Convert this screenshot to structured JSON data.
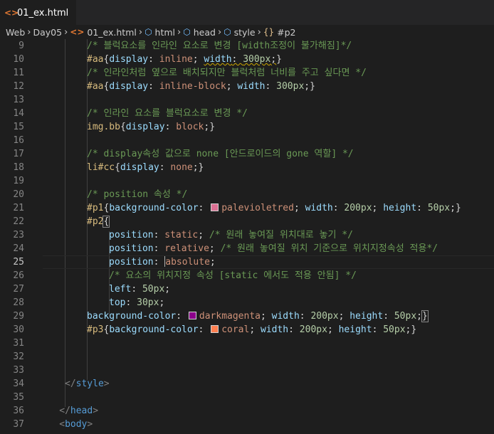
{
  "tab": {
    "filename": "01_ex.html",
    "icon": "html-file-icon"
  },
  "breadcrumb": {
    "items": [
      "Web",
      "Day05",
      "01_ex.html",
      "html",
      "head",
      "style",
      "#p2"
    ]
  },
  "editor": {
    "lines": [
      {
        "num": "9",
        "indent": 2,
        "tokens": [
          [
            "com",
            "/* 블럭요소를 인라인 요소로 변경 [width조정이 불가해짐]*/"
          ]
        ]
      },
      {
        "num": "10",
        "indent": 2,
        "tokens": [
          [
            "sel",
            "#aa"
          ],
          [
            "pun",
            "{"
          ],
          [
            "prop",
            "display"
          ],
          [
            "pun",
            ": "
          ],
          [
            "val",
            "inline"
          ],
          [
            "pun",
            "; "
          ],
          [
            "prop",
            "width",
            "sq"
          ],
          [
            "pun",
            ": ",
            "sq"
          ],
          [
            "num",
            "300px",
            "sq"
          ],
          [
            "pun",
            ";",
            "sq"
          ],
          [
            "pun",
            "}"
          ]
        ]
      },
      {
        "num": "11",
        "indent": 2,
        "tokens": [
          [
            "com",
            "/* 인라인처럼 옆으로 배치되지만 블럭처럼 너비를 주고 싶다면 */"
          ]
        ]
      },
      {
        "num": "12",
        "indent": 2,
        "tokens": [
          [
            "sel",
            "#aa"
          ],
          [
            "pun",
            "{"
          ],
          [
            "prop",
            "display"
          ],
          [
            "pun",
            ": "
          ],
          [
            "val",
            "inline-block"
          ],
          [
            "pun",
            "; "
          ],
          [
            "prop",
            "width"
          ],
          [
            "pun",
            ": "
          ],
          [
            "num",
            "300px"
          ],
          [
            "pun",
            ";}"
          ]
        ]
      },
      {
        "num": "13",
        "indent": 0,
        "tokens": []
      },
      {
        "num": "14",
        "indent": 2,
        "tokens": [
          [
            "com",
            "/* 인라인 요소를 블럭요소로 변경 */"
          ]
        ]
      },
      {
        "num": "15",
        "indent": 2,
        "tokens": [
          [
            "sel",
            "img.bb"
          ],
          [
            "pun",
            "{"
          ],
          [
            "prop",
            "display"
          ],
          [
            "pun",
            ": "
          ],
          [
            "val",
            "block"
          ],
          [
            "pun",
            ";}"
          ]
        ]
      },
      {
        "num": "16",
        "indent": 0,
        "tokens": []
      },
      {
        "num": "17",
        "indent": 2,
        "tokens": [
          [
            "com",
            "/* display속성 값으로 none [안드로이드의 gone 역할] */"
          ]
        ]
      },
      {
        "num": "18",
        "indent": 2,
        "tokens": [
          [
            "sel",
            "li#cc"
          ],
          [
            "pun",
            "{"
          ],
          [
            "prop",
            "display"
          ],
          [
            "pun",
            ": "
          ],
          [
            "val",
            "none"
          ],
          [
            "pun",
            ";}"
          ]
        ]
      },
      {
        "num": "19",
        "indent": 0,
        "tokens": []
      },
      {
        "num": "20",
        "indent": 2,
        "tokens": [
          [
            "com",
            "/* position 속성 */"
          ]
        ]
      },
      {
        "num": "21",
        "indent": 2,
        "tokens": [
          [
            "sel",
            "#p1"
          ],
          [
            "pun",
            "{"
          ],
          [
            "prop",
            "background-color"
          ],
          [
            "pun",
            ": "
          ],
          [
            "swatch",
            "#db7093"
          ],
          [
            "val",
            "palevioletred"
          ],
          [
            "pun",
            "; "
          ],
          [
            "prop",
            "width"
          ],
          [
            "pun",
            ": "
          ],
          [
            "num",
            "200px"
          ],
          [
            "pun",
            "; "
          ],
          [
            "prop",
            "height"
          ],
          [
            "pun",
            ": "
          ],
          [
            "num",
            "50px"
          ],
          [
            "pun",
            ";}"
          ]
        ]
      },
      {
        "num": "22",
        "indent": 2,
        "tokens": [
          [
            "sel",
            "#p2"
          ],
          [
            "pun",
            "{",
            "hl"
          ]
        ]
      },
      {
        "num": "23",
        "indent": 3,
        "tokens": [
          [
            "prop",
            "position"
          ],
          [
            "pun",
            ": "
          ],
          [
            "val",
            "static"
          ],
          [
            "pun",
            "; "
          ],
          [
            "com",
            "/* 원래 놓여질 위치대로 놓기 */"
          ]
        ]
      },
      {
        "num": "24",
        "indent": 3,
        "tokens": [
          [
            "prop",
            "position"
          ],
          [
            "pun",
            ": "
          ],
          [
            "val",
            "relative"
          ],
          [
            "pun",
            "; "
          ],
          [
            "com",
            "/* 원래 놓여질 위치 기준으로 위치지정속성 적용*/"
          ]
        ]
      },
      {
        "num": "25",
        "indent": 3,
        "current": true,
        "tokens": [
          [
            "prop",
            "position"
          ],
          [
            "pun",
            ": "
          ],
          [
            "caret",
            ""
          ],
          [
            "val",
            "absolute"
          ],
          [
            "pun",
            ";"
          ]
        ]
      },
      {
        "num": "26",
        "indent": 3,
        "tokens": [
          [
            "com",
            "/* 요소의 위치지정 속성 [static 에서도 적용 안됨] */"
          ]
        ]
      },
      {
        "num": "27",
        "indent": 3,
        "tokens": [
          [
            "prop",
            "left"
          ],
          [
            "pun",
            ": "
          ],
          [
            "num",
            "50px"
          ],
          [
            "pun",
            ";"
          ]
        ]
      },
      {
        "num": "28",
        "indent": 3,
        "tokens": [
          [
            "prop",
            "top"
          ],
          [
            "pun",
            ": "
          ],
          [
            "num",
            "30px"
          ],
          [
            "pun",
            ";"
          ]
        ]
      },
      {
        "num": "29",
        "indent": 2,
        "tokens": [
          [
            "prop",
            "background-color"
          ],
          [
            "pun",
            ": "
          ],
          [
            "swatch",
            "#8b008b"
          ],
          [
            "val",
            "darkmagenta"
          ],
          [
            "pun",
            "; "
          ],
          [
            "prop",
            "width"
          ],
          [
            "pun",
            ": "
          ],
          [
            "num",
            "200px"
          ],
          [
            "pun",
            "; "
          ],
          [
            "prop",
            "height"
          ],
          [
            "pun",
            ": "
          ],
          [
            "num",
            "50px"
          ],
          [
            "pun",
            ";"
          ],
          [
            "pun",
            "}",
            "hl"
          ]
        ]
      },
      {
        "num": "30",
        "indent": 2,
        "tokens": [
          [
            "sel",
            "#p3"
          ],
          [
            "pun",
            "{"
          ],
          [
            "prop",
            "background-color"
          ],
          [
            "pun",
            ": "
          ],
          [
            "swatch",
            "#ff7f50"
          ],
          [
            "val",
            "coral"
          ],
          [
            "pun",
            "; "
          ],
          [
            "prop",
            "width"
          ],
          [
            "pun",
            ": "
          ],
          [
            "num",
            "200px"
          ],
          [
            "pun",
            "; "
          ],
          [
            "prop",
            "height"
          ],
          [
            "pun",
            ": "
          ],
          [
            "num",
            "50px"
          ],
          [
            "pun",
            ";}"
          ]
        ]
      },
      {
        "num": "31",
        "indent": 0,
        "tokens": []
      },
      {
        "num": "32",
        "indent": 0,
        "tokens": []
      },
      {
        "num": "33",
        "indent": 0,
        "tokens": []
      },
      {
        "num": "34",
        "indent": 1,
        "tokens": [
          [
            "brk",
            "</"
          ],
          [
            "tag",
            "style"
          ],
          [
            "brk",
            ">"
          ]
        ]
      },
      {
        "num": "35",
        "indent": 0,
        "tokens": []
      },
      {
        "num": "36",
        "indent": 0.75,
        "tokens": [
          [
            "brk",
            "</"
          ],
          [
            "tag",
            "head"
          ],
          [
            "brk",
            ">"
          ]
        ]
      },
      {
        "num": "37",
        "indent": 0.75,
        "tokens": [
          [
            "brk",
            "<"
          ],
          [
            "tag",
            "body"
          ],
          [
            "brk",
            ">"
          ]
        ]
      }
    ]
  },
  "colors": {
    "background": "#1e1e1e",
    "comment": "#6a9955",
    "selector": "#d7ba7d",
    "property": "#9cdcfe",
    "value": "#ce9178",
    "number": "#b5cea8",
    "tag": "#569cd6"
  }
}
